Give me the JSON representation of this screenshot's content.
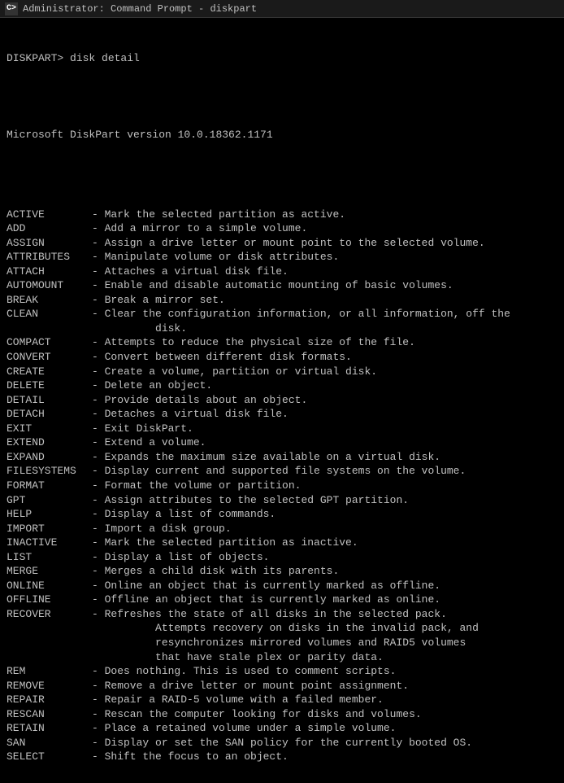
{
  "titleBar": {
    "icon": "C>",
    "title": "Administrator: Command Prompt - diskpart"
  },
  "prompt": "DISKPART> disk detail",
  "version": "Microsoft DiskPart version 10.0.18362.1171",
  "commands": [
    {
      "key": "ACTIVE",
      "desc": "- Mark the selected partition as active."
    },
    {
      "key": "ADD",
      "desc": "- Add a mirror to a simple volume."
    },
    {
      "key": "ASSIGN",
      "desc": "- Assign a drive letter or mount point to the selected volume."
    },
    {
      "key": "ATTRIBUTES",
      "desc": "- Manipulate volume or disk attributes."
    },
    {
      "key": "ATTACH",
      "desc": "- Attaches a virtual disk file."
    },
    {
      "key": "AUTOMOUNT",
      "desc": "- Enable and disable automatic mounting of basic volumes."
    },
    {
      "key": "BREAK",
      "desc": "- Break a mirror set."
    },
    {
      "key": "CLEAN",
      "desc": "- Clear the configuration information, or all information, off the\n          disk."
    },
    {
      "key": "COMPACT",
      "desc": "- Attempts to reduce the physical size of the file."
    },
    {
      "key": "CONVERT",
      "desc": "- Convert between different disk formats."
    },
    {
      "key": "CREATE",
      "desc": "- Create a volume, partition or virtual disk."
    },
    {
      "key": "DELETE",
      "desc": "- Delete an object."
    },
    {
      "key": "DETAIL",
      "desc": "- Provide details about an object."
    },
    {
      "key": "DETACH",
      "desc": "- Detaches a virtual disk file."
    },
    {
      "key": "EXIT",
      "desc": "- Exit DiskPart."
    },
    {
      "key": "EXTEND",
      "desc": "- Extend a volume."
    },
    {
      "key": "EXPAND",
      "desc": "- Expands the maximum size available on a virtual disk."
    },
    {
      "key": "FILESYSTEMS",
      "desc": "- Display current and supported file systems on the volume."
    },
    {
      "key": "FORMAT",
      "desc": "- Format the volume or partition."
    },
    {
      "key": "GPT",
      "desc": "- Assign attributes to the selected GPT partition."
    },
    {
      "key": "HELP",
      "desc": "- Display a list of commands."
    },
    {
      "key": "IMPORT",
      "desc": "- Import a disk group."
    },
    {
      "key": "INACTIVE",
      "desc": "- Mark the selected partition as inactive."
    },
    {
      "key": "LIST",
      "desc": "- Display a list of objects."
    },
    {
      "key": "MERGE",
      "desc": "- Merges a child disk with its parents."
    },
    {
      "key": "ONLINE",
      "desc": "- Online an object that is currently marked as offline."
    },
    {
      "key": "OFFLINE",
      "desc": "- Offline an object that is currently marked as online."
    },
    {
      "key": "RECOVER",
      "desc": "- Refreshes the state of all disks in the selected pack.\n          Attempts recovery on disks in the invalid pack, and\n          resynchronizes mirrored volumes and RAID5 volumes\n          that have stale plex or parity data."
    },
    {
      "key": "REM",
      "desc": "- Does nothing. This is used to comment scripts."
    },
    {
      "key": "REMOVE",
      "desc": "- Remove a drive letter or mount point assignment."
    },
    {
      "key": "REPAIR",
      "desc": "- Repair a RAID-5 volume with a failed member."
    },
    {
      "key": "RESCAN",
      "desc": "- Rescan the computer looking for disks and volumes."
    },
    {
      "key": "RETAIN",
      "desc": "- Place a retained volume under a simple volume."
    },
    {
      "key": "SAN",
      "desc": "- Display or set the SAN policy for the currently booted OS."
    },
    {
      "key": "SELECT",
      "desc": "- Shift the focus to an object."
    }
  ]
}
